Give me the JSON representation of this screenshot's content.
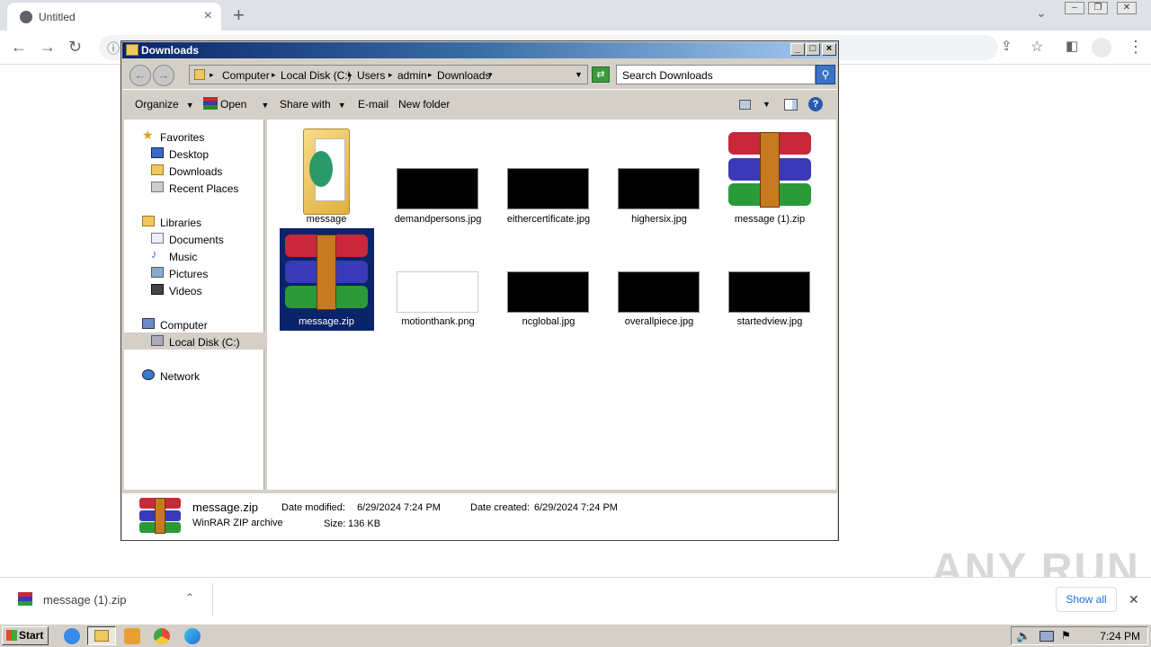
{
  "browser": {
    "tab_title": "Untitled",
    "tab_close": "×",
    "new_tab": "+"
  },
  "explorer": {
    "window_title": "Downloads",
    "title_buttons": {
      "minimize": "_",
      "maximize": "□",
      "close": "×"
    },
    "breadcrumbs": [
      "Computer",
      "Local Disk (C:)",
      "Users",
      "admin",
      "Downloads"
    ],
    "search_placeholder": "Search Downloads",
    "commands": {
      "organize": "Organize",
      "open": "Open",
      "share_with": "Share with",
      "email": "E-mail",
      "new_folder": "New folder"
    },
    "nav": {
      "favorites": "Favorites",
      "desktop": "Desktop",
      "downloads": "Downloads",
      "recent_places": "Recent Places",
      "libraries": "Libraries",
      "documents": "Documents",
      "music": "Music",
      "pictures": "Pictures",
      "videos": "Videos",
      "computer": "Computer",
      "local_disk": "Local Disk (C:)",
      "network": "Network"
    },
    "files": [
      {
        "name": "message",
        "kind": "folder"
      },
      {
        "name": "demandpersons.jpg",
        "kind": "image-dark"
      },
      {
        "name": "eithercertificate.jpg",
        "kind": "image-dark"
      },
      {
        "name": "highersix.jpg",
        "kind": "image-dark"
      },
      {
        "name": "message (1).zip",
        "kind": "winrar"
      },
      {
        "name": "message.zip",
        "kind": "winrar",
        "selected": true
      },
      {
        "name": "motionthank.png",
        "kind": "image-light"
      },
      {
        "name": "ncglobal.jpg",
        "kind": "image-dark"
      },
      {
        "name": "overallpiece.jpg",
        "kind": "image-dark"
      },
      {
        "name": "startedview.jpg",
        "kind": "image-dark"
      }
    ],
    "status": {
      "filename": "message.zip",
      "type": "WinRAR ZIP archive",
      "modified_label": "Date modified:",
      "modified_value": "6/29/2024 7:24 PM",
      "created_label": "Date created:",
      "created_value": "6/29/2024 7:24 PM",
      "size_label": "Size:",
      "size_value": "136 KB"
    }
  },
  "download_bar": {
    "item_name": "message (1).zip",
    "show_all": "Show all",
    "close": "✕"
  },
  "watermark": "ANY RUN",
  "taskbar": {
    "start": "Start",
    "clock": "7:24 PM"
  }
}
